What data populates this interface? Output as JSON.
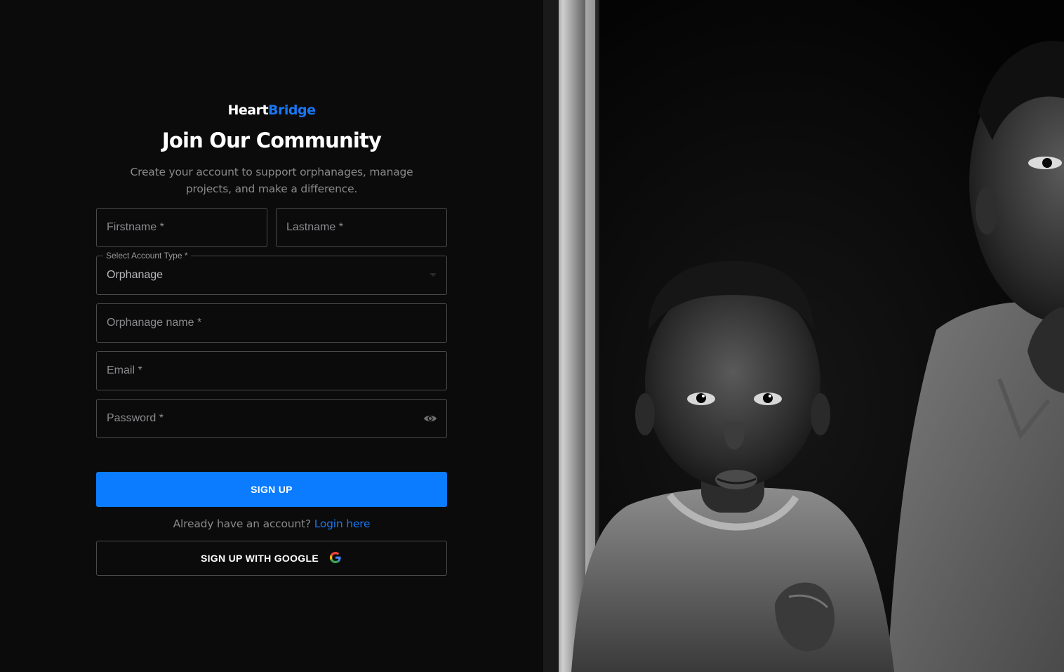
{
  "brand": {
    "part1": "Heart",
    "part2": "Bridge"
  },
  "title": "Join Our Community",
  "subtitle": "Create your account to support orphanages, manage projects, and make a difference.",
  "form": {
    "firstname_placeholder": "Firstname *",
    "lastname_placeholder": "Lastname *",
    "account_type_label": "Select Account Type *",
    "account_type_value": "Orphanage",
    "orphanage_name_placeholder": "Orphanage name *",
    "email_placeholder": "Email *",
    "password_placeholder": "Password *"
  },
  "buttons": {
    "signup": "SIGN UP",
    "google": "SIGN UP WITH GOOGLE"
  },
  "login_prompt": {
    "text": "Already have an account?",
    "link": "Login here"
  },
  "colors": {
    "accent": "#0b7bff",
    "link": "#1877f2",
    "background": "#0b0b0c"
  },
  "icons": {
    "password_toggle": "eye-icon",
    "google": "google-icon"
  },
  "image": {
    "alt": "Black and white photo of two children in a doorway"
  }
}
